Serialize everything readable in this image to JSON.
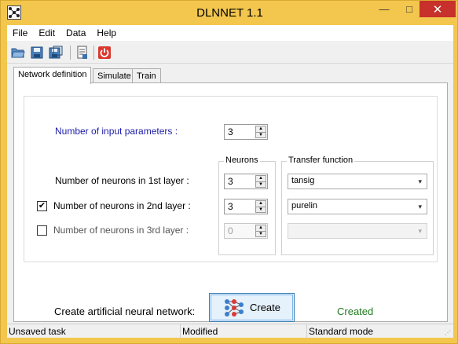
{
  "window": {
    "title": "DLNNET 1.1",
    "icons": {
      "app": "network-app-icon",
      "minimize": "minimize-icon",
      "maximize": "maximize-icon",
      "close": "close-icon"
    },
    "minimize_glyph": "—",
    "maximize_glyph": "□",
    "close_glyph": "✕",
    "colors": {
      "frame": "#f3c64d",
      "close": "#c7302b"
    }
  },
  "menu": {
    "items": [
      {
        "label": "File"
      },
      {
        "label": "Edit"
      },
      {
        "label": "Data"
      },
      {
        "label": "Help"
      }
    ]
  },
  "toolbar": {
    "buttons": [
      {
        "icon": "open-folder-icon"
      },
      {
        "icon": "save-icon"
      },
      {
        "icon": "save-as-icon"
      },
      {
        "icon": "document-report-icon"
      },
      {
        "icon": "power-exit-icon"
      }
    ]
  },
  "tabs": [
    {
      "label": "Network definition",
      "active": true
    },
    {
      "label": "Simulate",
      "active": false
    },
    {
      "label": "Train",
      "active": false
    }
  ],
  "network_definition": {
    "input_parameters": {
      "label": "Number of input parameters :",
      "value": "3"
    },
    "neurons_header": "Neurons",
    "transfer_header": "Transfer function",
    "layers": [
      {
        "label": "Number of neurons in 1st layer :",
        "neurons": "3",
        "transfer": "tansig",
        "has_checkbox": false,
        "checked": null,
        "enabled": true
      },
      {
        "label": "Number of neurons in 2nd layer :",
        "neurons": "3",
        "transfer": "purelin",
        "has_checkbox": true,
        "checked": true,
        "enabled": true
      },
      {
        "label": "Number of neurons in 3rd layer :",
        "neurons": "0",
        "transfer": "",
        "has_checkbox": true,
        "checked": false,
        "enabled": false
      }
    ],
    "check_glyph": "✔",
    "spin_up": "▲",
    "spin_down": "▼",
    "combo_caret": "▾"
  },
  "create": {
    "label": "Create artificial neural network:",
    "button_label": "Create",
    "button_icon": "neural-network-icon",
    "status": "Created",
    "status_color": "#1d7a1d"
  },
  "statusbar": {
    "cells": [
      "Unsaved task",
      "Modified",
      "Standard mode"
    ],
    "grip": "⋰"
  }
}
